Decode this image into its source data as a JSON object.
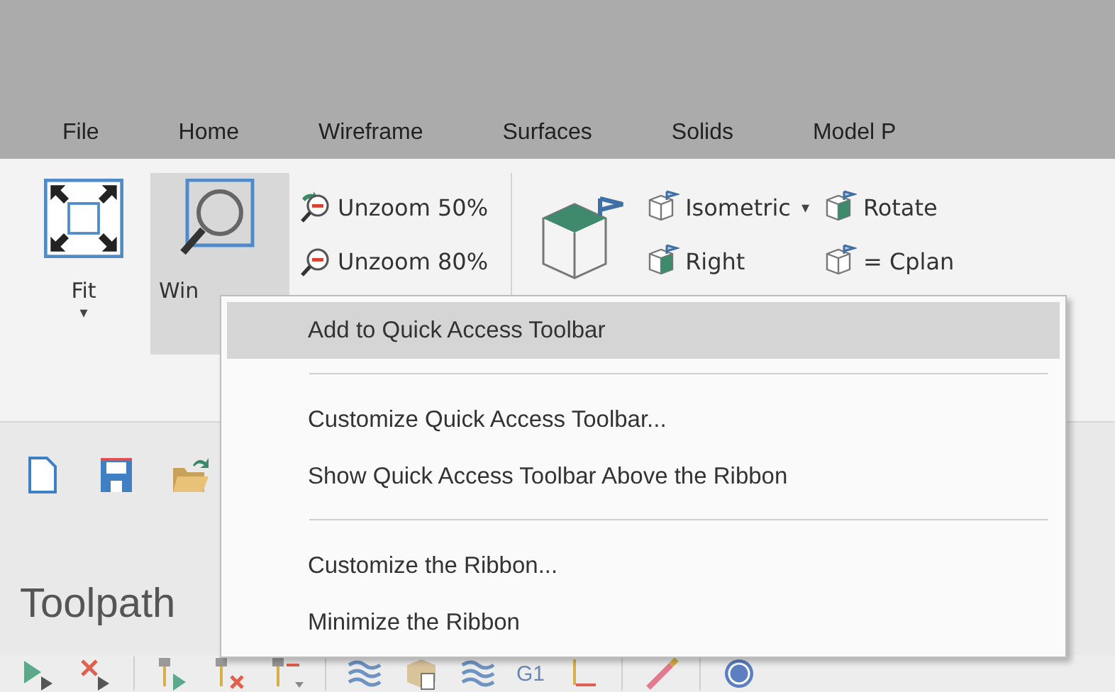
{
  "tabs": [
    {
      "label": "File",
      "selected": false
    },
    {
      "label": "Home",
      "selected": false
    },
    {
      "label": "Wireframe",
      "selected": false
    },
    {
      "label": "Surfaces",
      "selected": false
    },
    {
      "label": "Solids",
      "selected": false
    },
    {
      "label": "Model P",
      "selected": false
    }
  ],
  "ribbon": {
    "fit": {
      "label": "Fit",
      "caret": "▾"
    },
    "window": {
      "label": "Win",
      "selected": true
    },
    "zoom_items": [
      {
        "label": "Unzoom 50%"
      },
      {
        "label": "Unzoom 80%"
      }
    ],
    "view_items": [
      {
        "label": "Isometric",
        "caret": "▾"
      },
      {
        "label": "Right"
      }
    ],
    "plane_items": [
      {
        "label": "Rotate"
      },
      {
        "label": "= Cplan"
      }
    ]
  },
  "panel_title": "Toolpath",
  "toolbar_text": "G1",
  "context_menu": [
    {
      "kind": "item",
      "label": "Add to Quick Access Toolbar",
      "selected": true
    },
    {
      "kind": "separator"
    },
    {
      "kind": "item",
      "label": "Customize Quick Access Toolbar...",
      "selected": false
    },
    {
      "kind": "item",
      "label": "Show Quick Access Toolbar Above the Ribbon",
      "selected": false
    },
    {
      "kind": "separator"
    },
    {
      "kind": "item",
      "label": "Customize the Ribbon...",
      "selected": false
    },
    {
      "kind": "item",
      "label": "Minimize the Ribbon",
      "selected": false
    }
  ]
}
